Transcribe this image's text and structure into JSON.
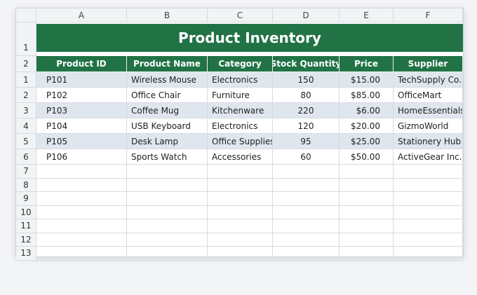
{
  "columns": [
    "A",
    "B",
    "C",
    "D",
    "E",
    "F"
  ],
  "title": "Product Inventory",
  "title_row_number": "1",
  "header_row_number": "2",
  "headers": [
    "Product ID",
    "Product Name",
    "Category",
    "Stock Quantity",
    "Price",
    "Supplier"
  ],
  "rows": [
    {
      "num": "1",
      "cells": [
        "P101",
        "Wireless Mouse",
        "Electronics",
        "150",
        "$15.00",
        "TechSupply Co."
      ]
    },
    {
      "num": "2",
      "cells": [
        "P102",
        "Office Chair",
        "Furniture",
        "80",
        "$85.00",
        "OfficeMart"
      ]
    },
    {
      "num": "3",
      "cells": [
        "P103",
        "Coffee Mug",
        "Kitchenware",
        "220",
        "$6.00",
        "HomeEssentials"
      ]
    },
    {
      "num": "4",
      "cells": [
        "P104",
        "USB Keyboard",
        "Electronics",
        "120",
        "$20.00",
        "GizmoWorld"
      ]
    },
    {
      "num": "5",
      "cells": [
        "P105",
        "Desk Lamp",
        "Office Supplies",
        "95",
        "$25.00",
        "Stationery Hub"
      ]
    },
    {
      "num": "6",
      "cells": [
        "P106",
        "Sports Watch",
        "Accessories",
        "60",
        "$50.00",
        "ActiveGear Inc."
      ]
    }
  ],
  "empty_rows": [
    "7",
    "8",
    "9",
    "10",
    "11",
    "12",
    "13"
  ],
  "colors": {
    "header_green": "#217346",
    "band": "#dfe6ee"
  }
}
